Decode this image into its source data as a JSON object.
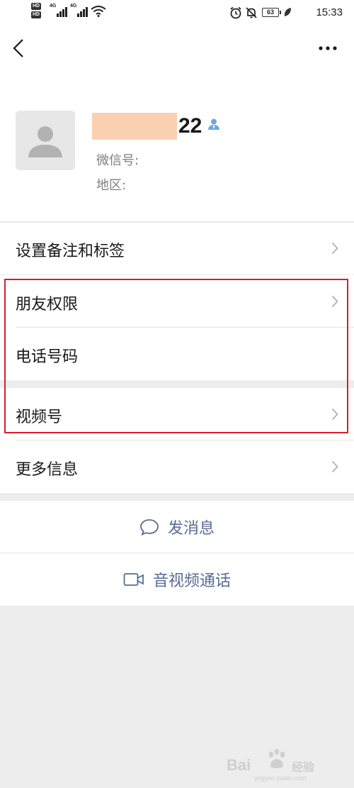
{
  "status_bar": {
    "time": "15:33",
    "battery": "63",
    "hd1": "HD",
    "hd2": "HD",
    "net1": "4G",
    "net2": "4G"
  },
  "profile": {
    "name_suffix": "22",
    "wechat_id_label": "微信号:",
    "region_label": "地区:"
  },
  "menu": {
    "remark_tags": "设置备注和标签",
    "friend_permissions": "朋友权限",
    "phone_number": "电话号码",
    "channels": "视频号",
    "more_info": "更多信息"
  },
  "actions": {
    "send_message": "发消息",
    "video_call": "音视频通话"
  },
  "watermark": {
    "brand_left": "Bai",
    "brand_right": "经验",
    "url": "jingyan.baidu.com"
  },
  "colors": {
    "link": "#576b95",
    "highlight": "#d6202c",
    "mask": "#fbd0b0"
  }
}
